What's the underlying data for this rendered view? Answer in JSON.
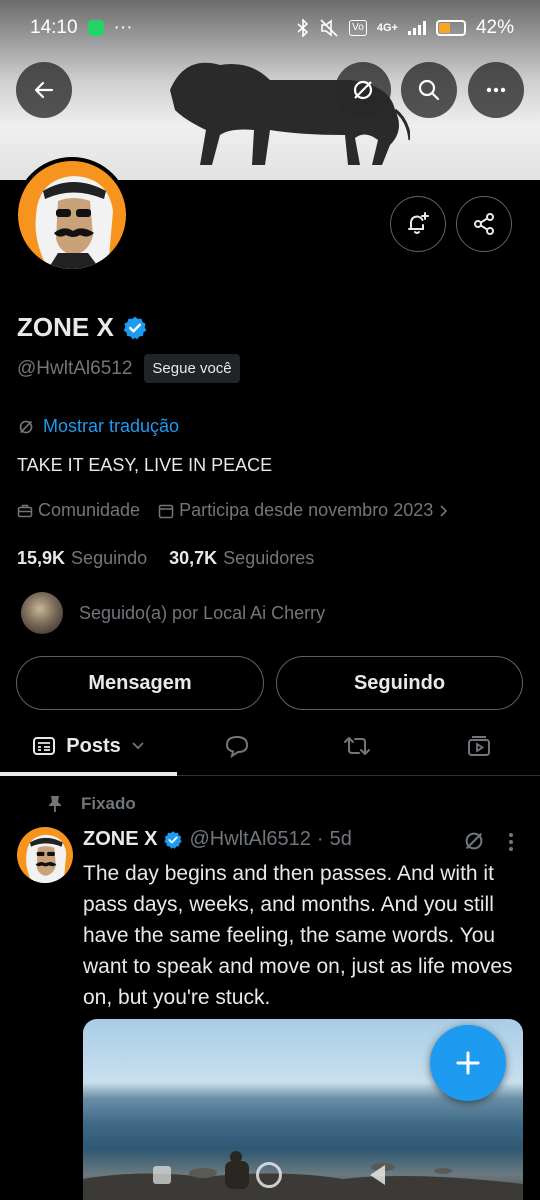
{
  "status_bar": {
    "time": "14:10",
    "dots": "···",
    "network": "4G+",
    "battery_percent": "42%",
    "battery_level": 0.42,
    "icons": [
      "whatsapp-icon",
      "bluetooth-icon",
      "mute-icon",
      "volte-icon",
      "signal-icon",
      "battery-icon"
    ]
  },
  "profile": {
    "name": "ZONE X",
    "handle": "@HwltAl6512",
    "follows_you": "Segue você",
    "translate_label": "Mostrar tradução",
    "bio": "TAKE IT EASY, LIVE IN PEACE",
    "category": "Comunidade",
    "joined": "Participa desde novembro 2023",
    "following_count": "15,9K",
    "following_label": "Seguindo",
    "followers_count": "30,7K",
    "followers_label": "Seguidores",
    "followed_by": "Seguido(a) por Local Ai Cherry"
  },
  "actions": {
    "message_label": "Mensagem",
    "following_label": "Seguindo"
  },
  "tabs": {
    "posts_label": "Posts",
    "icons": [
      "replies-icon",
      "retweets-icon",
      "media-icon"
    ]
  },
  "post": {
    "pinned_label": "Fixado",
    "author_name": "ZONE X",
    "author_handle": "@HwltAl6512",
    "separator": "·",
    "time": "5d",
    "text": "The day begins and then passes. And with it pass days, weeks, and months. And you still have the same feeling, the same words. You want to speak and move on, just as life moves on, but you're stuck."
  },
  "colors": {
    "accent": "#1d9bf0",
    "background": "#000000",
    "text_primary": "#e7e9ea",
    "text_secondary": "#71767b",
    "avatar_bg": "#f7941d"
  }
}
